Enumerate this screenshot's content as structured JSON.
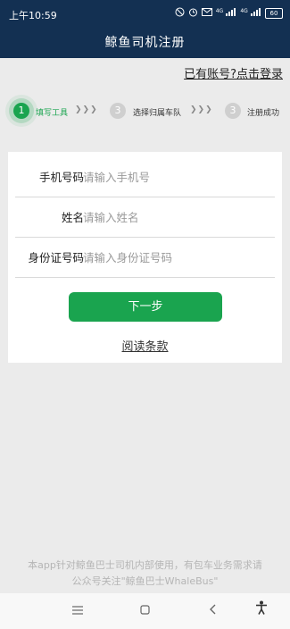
{
  "status_bar": {
    "time": "上午10:59",
    "icons": [
      "do-not-disturb-icon",
      "alarm-icon",
      "signal-4g-icon",
      "signal-4g-icon"
    ],
    "net1": "4G",
    "net2": "4G",
    "battery": "60"
  },
  "header": {
    "title": "鲸鱼司机注册"
  },
  "login_link": "已有账号?点击登录",
  "steps": [
    {
      "number": "1",
      "label": "填写工具",
      "state": "active"
    },
    {
      "number": "3",
      "label": "选择归属车队",
      "state": "inactive"
    },
    {
      "number": "3",
      "label": "注册成功",
      "state": "inactive"
    }
  ],
  "step_separator": "❯❯❯",
  "form": {
    "phone": {
      "label": "手机号码",
      "placeholder": "请输入手机号"
    },
    "name": {
      "label": "姓名",
      "placeholder": "请输入姓名"
    },
    "id_card": {
      "label": "身份证号码",
      "placeholder": "请输入身份证号码"
    },
    "next_button": "下一步",
    "terms_link": "阅读条款"
  },
  "footer": {
    "line1": "本app针对鲸鱼巴士司机内部使用，有包车业务需求请",
    "line2": "公众号关注\"鲸鱼巴士WhaleBus\""
  },
  "nav_bar": {
    "menu_glyph": "≡",
    "home_glyph": "▢",
    "back_glyph": "‹",
    "accessibility_glyph": "♿"
  },
  "colors": {
    "header_bg": "#133052",
    "accent_green": "#1aa44f",
    "page_bg": "#ebebeb"
  }
}
